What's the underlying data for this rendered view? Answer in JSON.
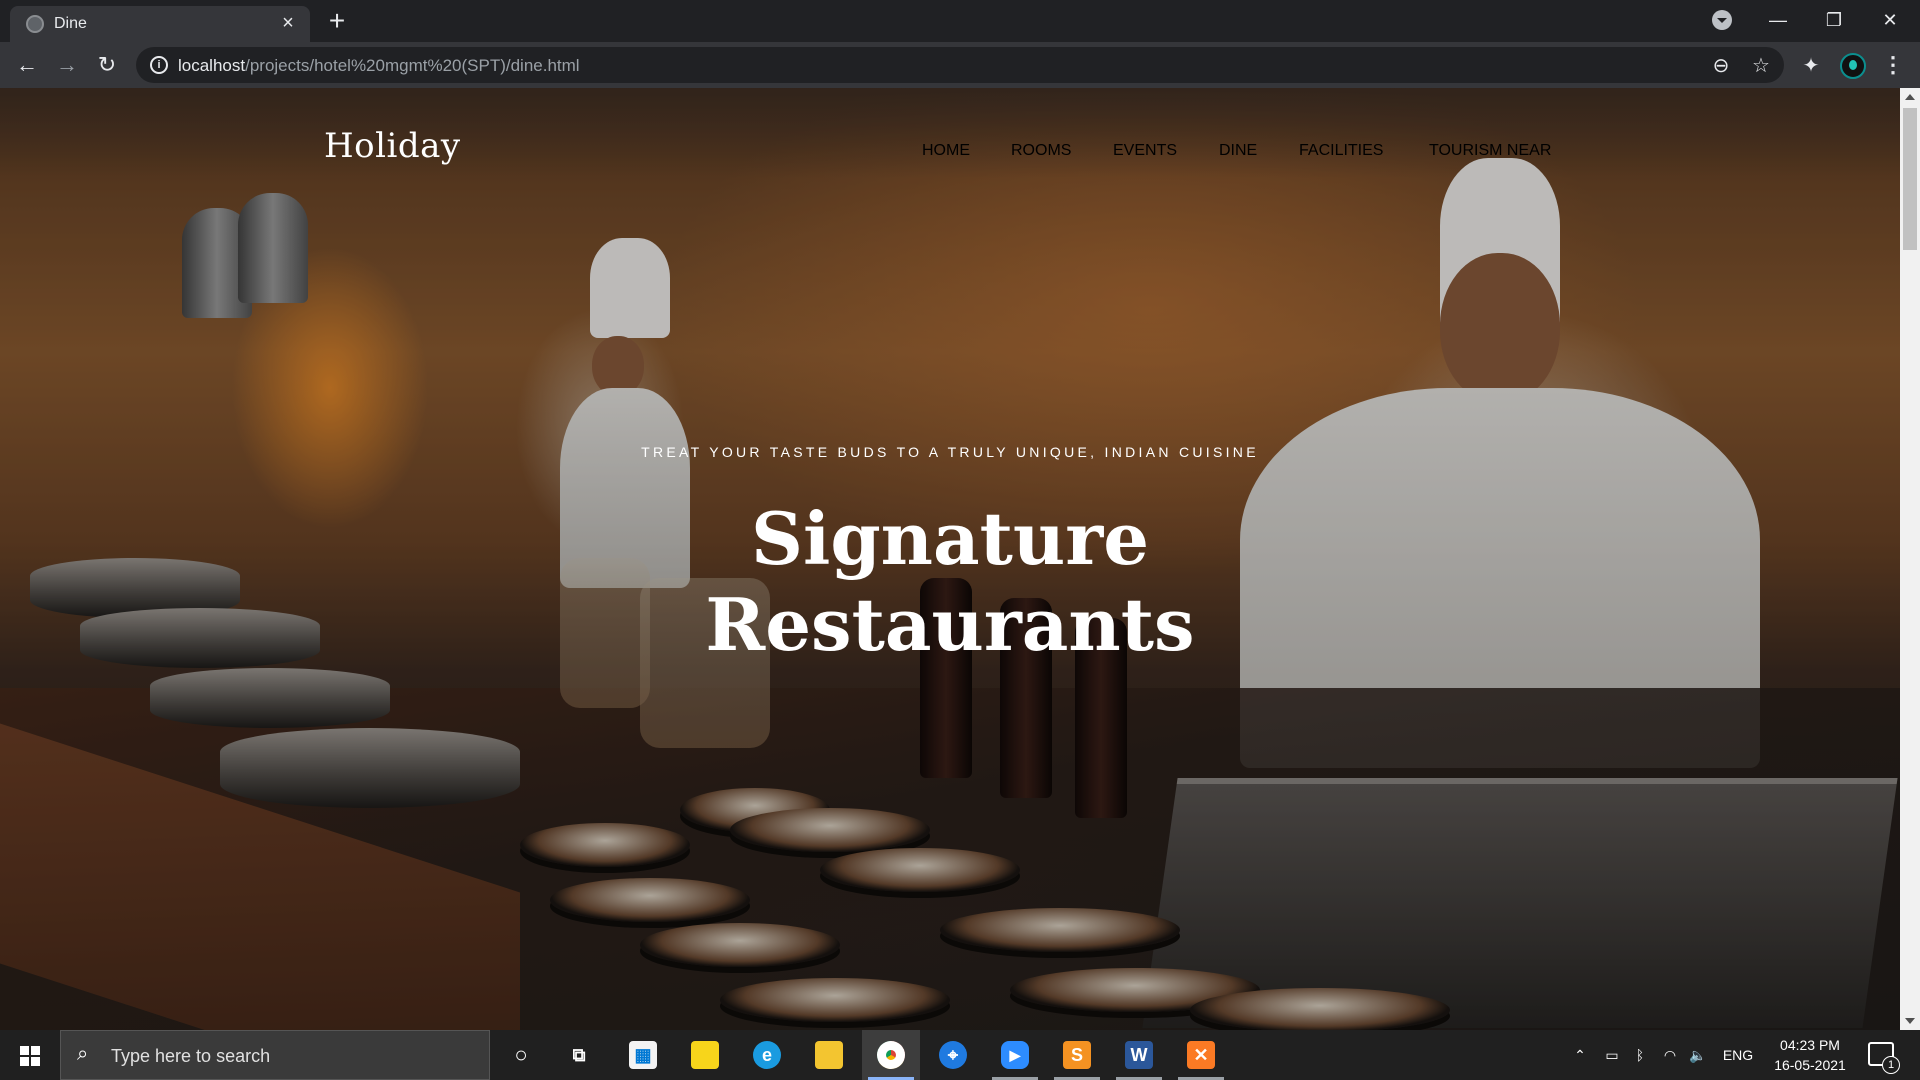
{
  "browser": {
    "tab_title": "Dine",
    "new_tab_symbol": "+",
    "url_host": "localhost",
    "url_path": "/projects/hotel%20mgmt%20(SPT)/dine.html",
    "window_controls": {
      "minimize": "—",
      "restore": "❐",
      "close": "✕"
    }
  },
  "site": {
    "logo": "Holiday",
    "nav": [
      {
        "label": "HOME",
        "active": false
      },
      {
        "label": "ROOMS",
        "active": false
      },
      {
        "label": "EVENTS",
        "active": false
      },
      {
        "label": "DINE",
        "active": true
      },
      {
        "label": "FACILITIES",
        "active": false
      },
      {
        "label": "TOURISM NEAR",
        "active": false
      }
    ],
    "hero": {
      "subtitle": "TREAT YOUR TASTE BUDS TO A TRULY UNIQUE, INDIAN CUISINE",
      "title_line1": "Signature",
      "title_line2": "Restaurants"
    }
  },
  "taskbar": {
    "search_placeholder": "Type here to search",
    "apps": [
      {
        "name": "cortana",
        "glyph": "○",
        "color": "#202020"
      },
      {
        "name": "task-view",
        "glyph": "⧉",
        "color": "#202020"
      },
      {
        "name": "store",
        "glyph": "🛍",
        "color": "#f3f3f3"
      },
      {
        "name": "sticky-notes",
        "glyph": "▰",
        "color": "#f7d51b"
      },
      {
        "name": "edge",
        "glyph": "e",
        "color": "#1a9be0"
      },
      {
        "name": "file-explorer",
        "glyph": "▭",
        "color": "#f3c530"
      },
      {
        "name": "chrome",
        "glyph": "◉",
        "color": "#db4437"
      },
      {
        "name": "safari-like",
        "glyph": "⌖",
        "color": "#1f7ae0"
      },
      {
        "name": "zoom",
        "glyph": "▶",
        "color": "#2d8cff"
      },
      {
        "name": "sublime",
        "glyph": "S",
        "color": "#f49222"
      },
      {
        "name": "word",
        "glyph": "W",
        "color": "#2b579a"
      },
      {
        "name": "xampp",
        "glyph": "✕",
        "color": "#fb7a24"
      }
    ],
    "language": "ENG",
    "time": "04:23 PM",
    "date": "16-05-2021",
    "notification_count": "1"
  },
  "colors": {
    "browser_bg": "#202124",
    "toolbar_bg": "#35363a",
    "taskbar_bg": "#202020",
    "text_white": "#ffffff"
  }
}
